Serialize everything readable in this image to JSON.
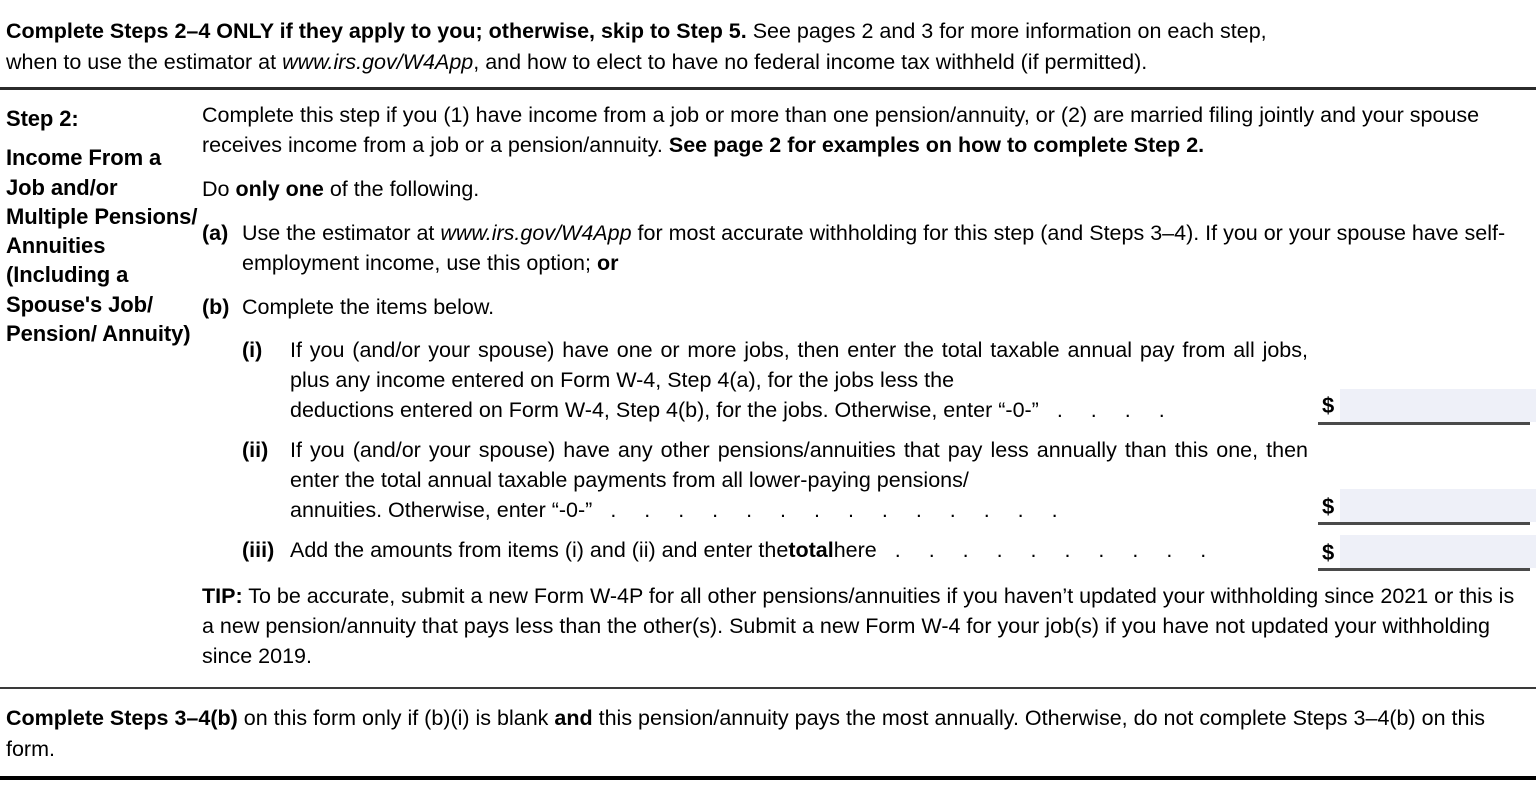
{
  "document": {
    "form_section": "Step 2",
    "header": {
      "bold_lead": "Complete Steps 2–4 ONLY if they apply to you; otherwise, skip to Step 5.",
      "rest_line1": " See pages 2 and 3 for more information on each step,",
      "line2_pre": "when to use the estimator at ",
      "line2_italic": "www.irs.gov/W4App",
      "line2_post": ", and how to elect to have no federal income tax withheld (if permitted)."
    },
    "step_label": {
      "title": "Step 2:",
      "description": "Income From a Job and/or Multiple Pensions/ Annuities (Including a Spouse's Job/ Pension/ Annuity)"
    },
    "intro": {
      "text_pre": "Complete this step if you (1) have income from a job or more than one pension/annuity, or (2) are married filing jointly and your spouse receives income from a job or a pension/annuity. ",
      "text_bold": "See page 2 for examples on how to complete Step 2."
    },
    "do_only_one": {
      "pre": "Do ",
      "bold": "only one",
      "post": " of the following."
    },
    "options": [
      {
        "marker": "(a)",
        "pre": "Use the estimator at ",
        "italic": "www.irs.gov/W4App",
        "mid": " for most accurate withholding for this step (and Steps 3–4). If you or your spouse have self-employment income, use this option; ",
        "bold_end": "or"
      },
      {
        "marker": "(b)",
        "text": "Complete the items below."
      }
    ],
    "items": [
      {
        "marker": "(i)",
        "text_block": "If you (and/or your spouse) have one or more jobs, then enter the total taxable annual pay from all jobs, plus any income entered on Form W-4, Step 4(a), for the jobs less the",
        "last_line": "deductions entered on Form W-4, Step 4(b), for the jobs. Otherwise, enter “-0-”",
        "leader": ". . . .",
        "currency_symbol": "$",
        "value": "",
        "placeholder": ""
      },
      {
        "marker": "(ii)",
        "text_block": "If you (and/or your spouse) have any other pensions/annuities that pay less annually than this one, then enter the total annual taxable payments from all lower-paying pensions/",
        "last_line": "annuities. Otherwise, enter “-0-”",
        "leader": ". . . . . . . . . . . . . .",
        "currency_symbol": "$",
        "value": "",
        "placeholder": ""
      },
      {
        "marker": "(iii)",
        "text_pre": "Add the amounts from items (i) and (ii) and enter the ",
        "text_bold": "total",
        "text_post": " here",
        "leader": ". . . . . . . . . .",
        "currency_symbol": "$",
        "value": "",
        "placeholder": ""
      }
    ],
    "tip": {
      "label": "TIP:",
      "text": " To be accurate, submit a new Form W-4P for all other pensions/annuities if you haven’t updated your withholding since 2021 or this is a new pension/annuity that pays less than the other(s). Submit a new Form W-4 for your job(s) if you have not updated your withholding since 2019."
    },
    "footer": {
      "bold_lead": "Complete Steps 3–4(b)",
      "mid1": " on this form only if (b)(i) is blank ",
      "bold_and": "and",
      "mid2": " this pension/annuity pays the most annually. Otherwise, do not complete Steps 3–4(b) on this form."
    },
    "colors": {
      "field_fill": "#eef0f8",
      "rule_dark": "#000000",
      "rule_gray": "#4a4a4a",
      "text": "#000000"
    }
  }
}
